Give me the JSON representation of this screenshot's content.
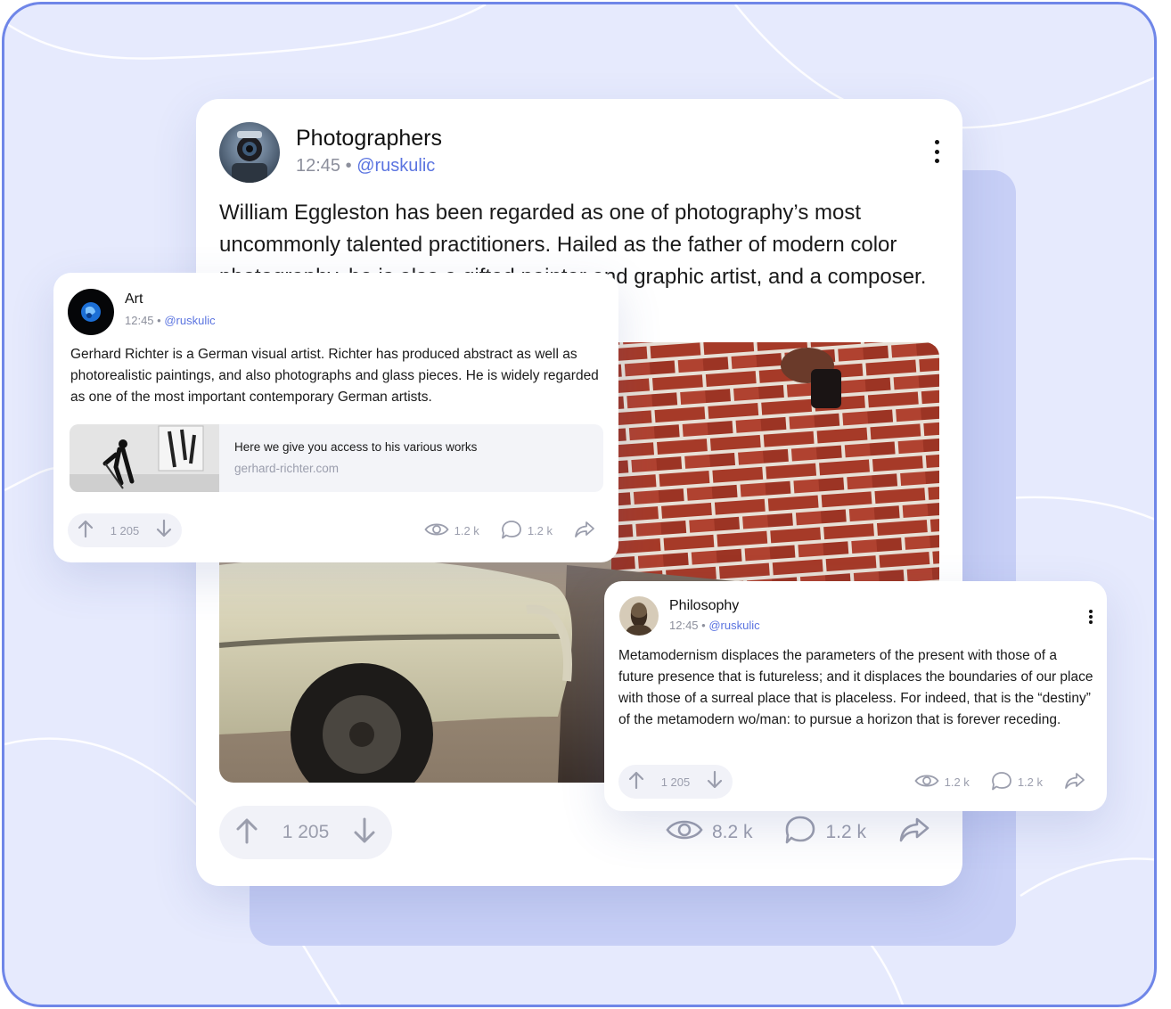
{
  "main_post": {
    "group": "Photographers",
    "time": "12:45",
    "separator": "•",
    "handle": "@ruskulic",
    "text": "William Eggleston has been regarded as one of photography’s most uncommonly talented practitioners. Hailed as the father of modern color photography, he is also a gifted painter and graphic artist, and a composer.",
    "votes": "1 205",
    "views": "8.2 k",
    "comments": "1.2 k"
  },
  "art_post": {
    "group": "Art",
    "time": "12:45",
    "separator": "•",
    "handle": "@ruskulic",
    "text": "Gerhard Richter is a German visual artist. Richter has produced abstract as well as photorealistic paintings, and also photographs and glass pieces. He is widely regarded as one of the most important contemporary German artists.",
    "link_title": "Here we give you access to his various works",
    "link_url": "gerhard-richter.com",
    "votes": "1 205",
    "views": "1.2 k",
    "comments": "1.2 k"
  },
  "philosophy_post": {
    "group": "Philosophy",
    "time": "12:45",
    "separator": "•",
    "handle": "@ruskulic",
    "text": "Metamodernism displaces the parameters of the present with those of a future presence that is futureless; and it displaces the boundaries of our place with those of a surreal place that is placeless. For indeed, that is the “destiny” of the metamodern wo/man: to pursue a horizon that is forever receding.",
    "votes": "1 205",
    "views": "1.2 k",
    "comments": "1.2 k"
  },
  "icons": {
    "upvote": "arrow-up-icon",
    "downvote": "arrow-down-icon",
    "views": "eye-icon",
    "comments": "comment-bubble-icon",
    "share": "share-icon",
    "menu": "more-vertical-icon"
  },
  "colors": {
    "background": "#e6eafd",
    "frame_border": "#6f86e8",
    "back_panel": "#c7cff6",
    "handle_accent": "#5b74e0",
    "muted_text": "#9b9ead"
  }
}
